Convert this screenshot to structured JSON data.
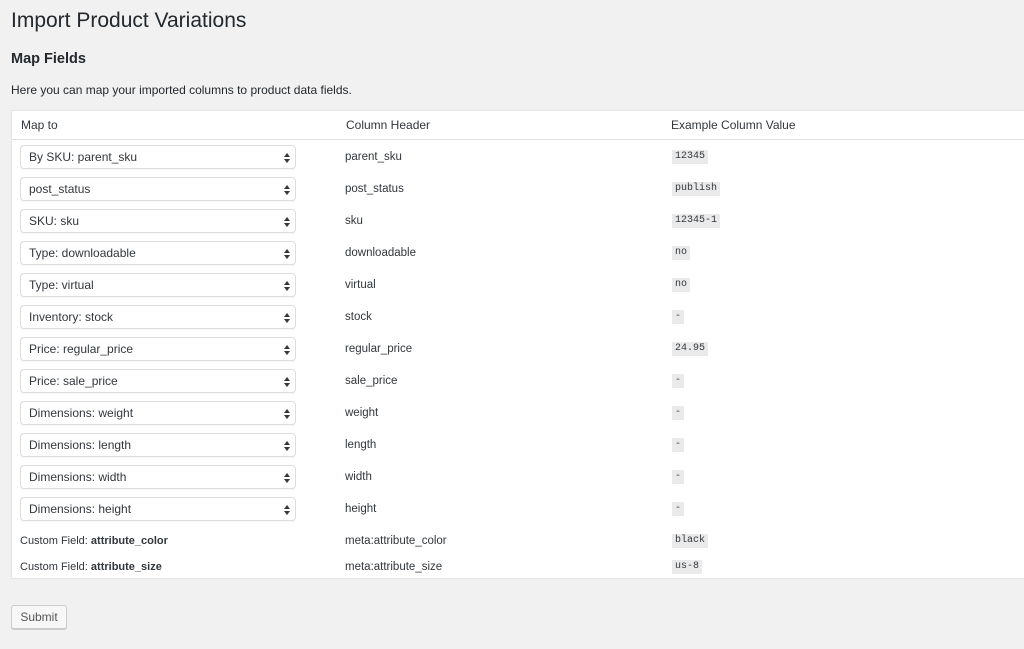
{
  "page": {
    "title": "Import Product Variations",
    "section_title": "Map Fields",
    "intro": "Here you can map your imported columns to product data fields."
  },
  "table": {
    "headers": [
      "Map to",
      "Column Header",
      "Example Column Value"
    ],
    "rows": [
      {
        "map_to": "By SKU: parent_sku",
        "column": "parent_sku",
        "example": "12345"
      },
      {
        "map_to": "post_status",
        "column": "post_status",
        "example": "publish"
      },
      {
        "map_to": "SKU: sku",
        "column": "sku",
        "example": "12345-1"
      },
      {
        "map_to": "Type: downloadable",
        "column": "downloadable",
        "example": "no"
      },
      {
        "map_to": "Type: virtual",
        "column": "virtual",
        "example": "no"
      },
      {
        "map_to": "Inventory: stock",
        "column": "stock",
        "example": "-"
      },
      {
        "map_to": "Price: regular_price",
        "column": "regular_price",
        "example": "24.95"
      },
      {
        "map_to": "Price: sale_price",
        "column": "sale_price",
        "example": "-"
      },
      {
        "map_to": "Dimensions: weight",
        "column": "weight",
        "example": "-"
      },
      {
        "map_to": "Dimensions: length",
        "column": "length",
        "example": "-"
      },
      {
        "map_to": "Dimensions: width",
        "column": "width",
        "example": "-"
      },
      {
        "map_to": "Dimensions: height",
        "column": "height",
        "example": "-"
      }
    ],
    "custom_rows": [
      {
        "prefix": "Custom Field: ",
        "name": "attribute_color",
        "column": "meta:attribute_color",
        "example": "black"
      },
      {
        "prefix": "Custom Field: ",
        "name": "attribute_size",
        "column": "meta:attribute_size",
        "example": "us-8"
      }
    ]
  },
  "icons": {
    "select_arrow": "updown-chevron-icon"
  },
  "buttons": {
    "submit_label": "Submit"
  }
}
